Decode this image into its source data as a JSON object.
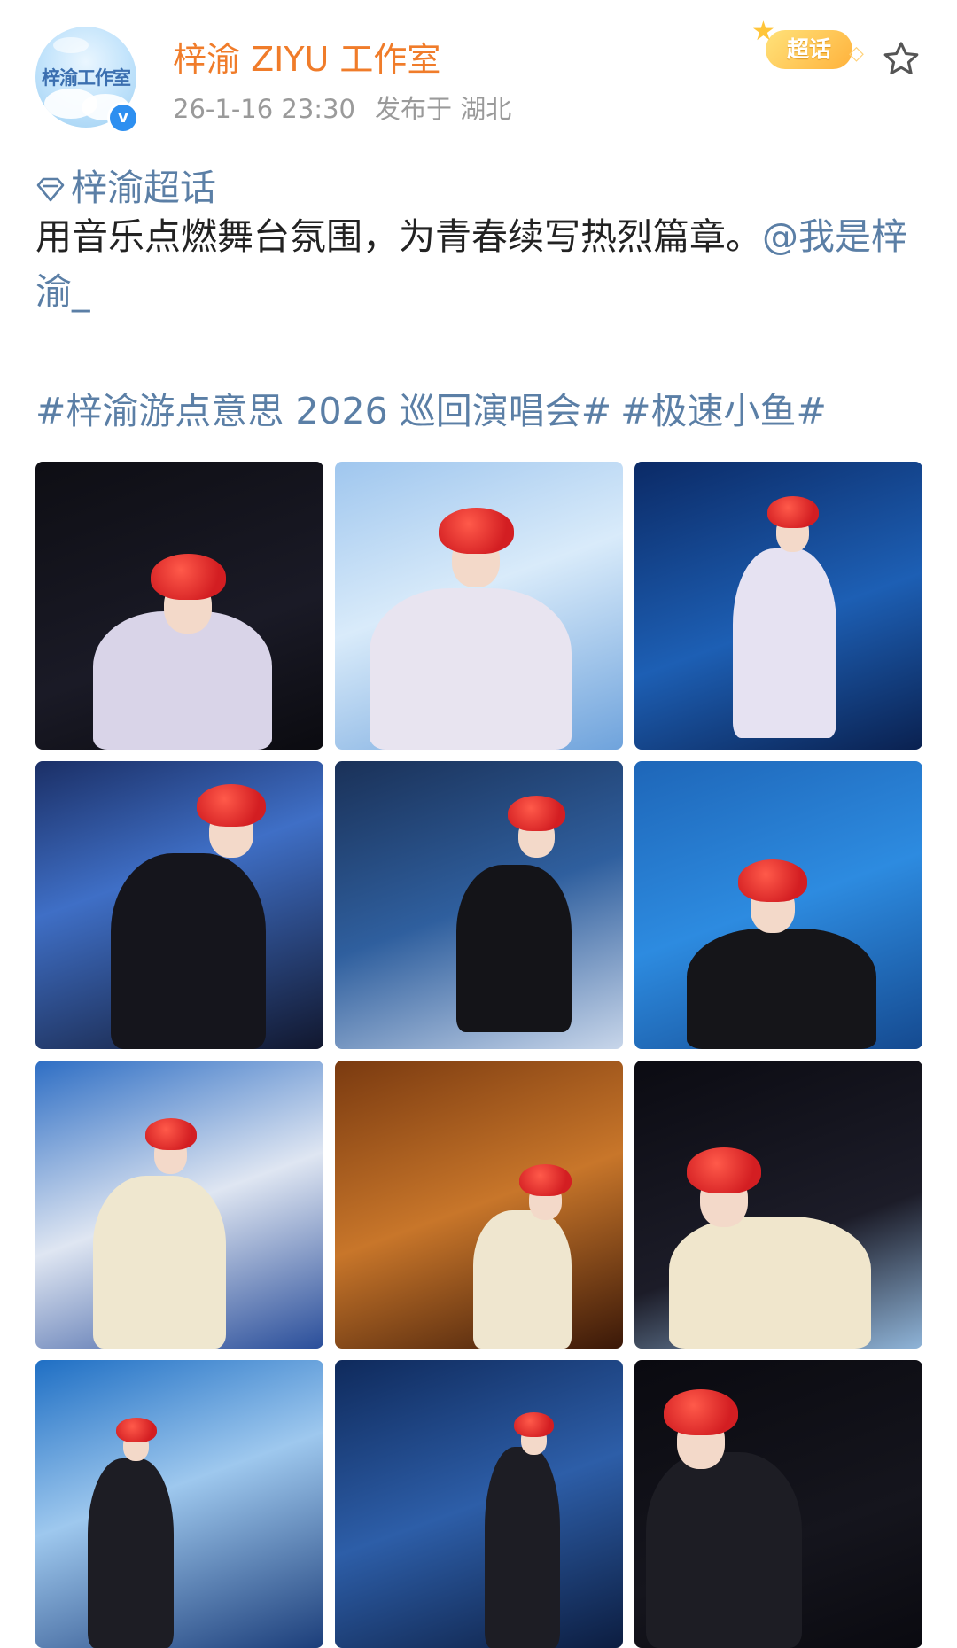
{
  "header": {
    "avatar_text": "梓渝工作室",
    "verified_mark": "v",
    "username": "梓渝 ZIYU 工作室",
    "time": "26-1-16 23:30",
    "location": "发布于 湖北",
    "chaohua_badge": "超话",
    "follow_icon": "star-outline-icon"
  },
  "post": {
    "topic": "梓渝超话",
    "text": "用音乐点燃舞台氛围，为青春续写热烈篇章。",
    "mention": "@我是梓渝_",
    "hashtags": [
      "#梓渝游点意思 2026 巡回演唱会#",
      "#极速小鱼#"
    ]
  },
  "colors": {
    "username": "#f07c2a",
    "link": "#5b7fa6",
    "meta": "#9a9a9a",
    "text": "#222222"
  },
  "photos": [
    {
      "alt": "photo-1",
      "bg": "linear-gradient(160deg,#0e0e14,#1a1a26 60%,#0b0b10)",
      "suit": "#d9d4e8"
    },
    {
      "alt": "photo-2",
      "bg": "linear-gradient(160deg,#9fc6ee,#d9ebfa 45%,#6fa3dc)",
      "suit": "#e8e4f0"
    },
    {
      "alt": "photo-3",
      "bg": "linear-gradient(160deg,#0b2a66,#1d5fb4 55%,#0a2150)",
      "suit": "#e6e2f2"
    },
    {
      "alt": "photo-4",
      "bg": "linear-gradient(160deg,#1b2f66,#3f6fc6 40%,#11172e)",
      "suit": "#15151c"
    },
    {
      "alt": "photo-5",
      "bg": "linear-gradient(160deg,#1a3158,#2f5f9e 50%,#c8d6ea)",
      "suit": "#141418"
    },
    {
      "alt": "photo-6",
      "bg": "linear-gradient(160deg,#1e66b8,#2d8be0 50%,#154a90)",
      "suit": "#151519"
    },
    {
      "alt": "photo-7",
      "bg": "linear-gradient(160deg,#2e6ec4,#dfe6f2 50%,#2a4e9a)",
      "suit": "#efe7cf"
    },
    {
      "alt": "photo-8",
      "bg": "linear-gradient(160deg,#7a3a10,#c8762a 50%,#3a1808)",
      "suit": "#efe6cf"
    },
    {
      "alt": "photo-9",
      "bg": "linear-gradient(160deg,#0b0b12,#1c1c28 60%,#8fb4d8)",
      "suit": "#f0e6cc"
    },
    {
      "alt": "photo-10",
      "bg": "linear-gradient(160deg,#1f6fc4,#9ec8ee 45%,#1c3e7a)",
      "suit": "#1d1d24"
    },
    {
      "alt": "photo-11",
      "bg": "linear-gradient(160deg,#0f2a5c,#2d5ea8 50%,#0c1d40)",
      "suit": "#1d1d24"
    },
    {
      "alt": "photo-12",
      "bg": "linear-gradient(160deg,#0a0a10,#15151d 60%,#0a0a10)",
      "suit": "#1d1d24"
    }
  ]
}
